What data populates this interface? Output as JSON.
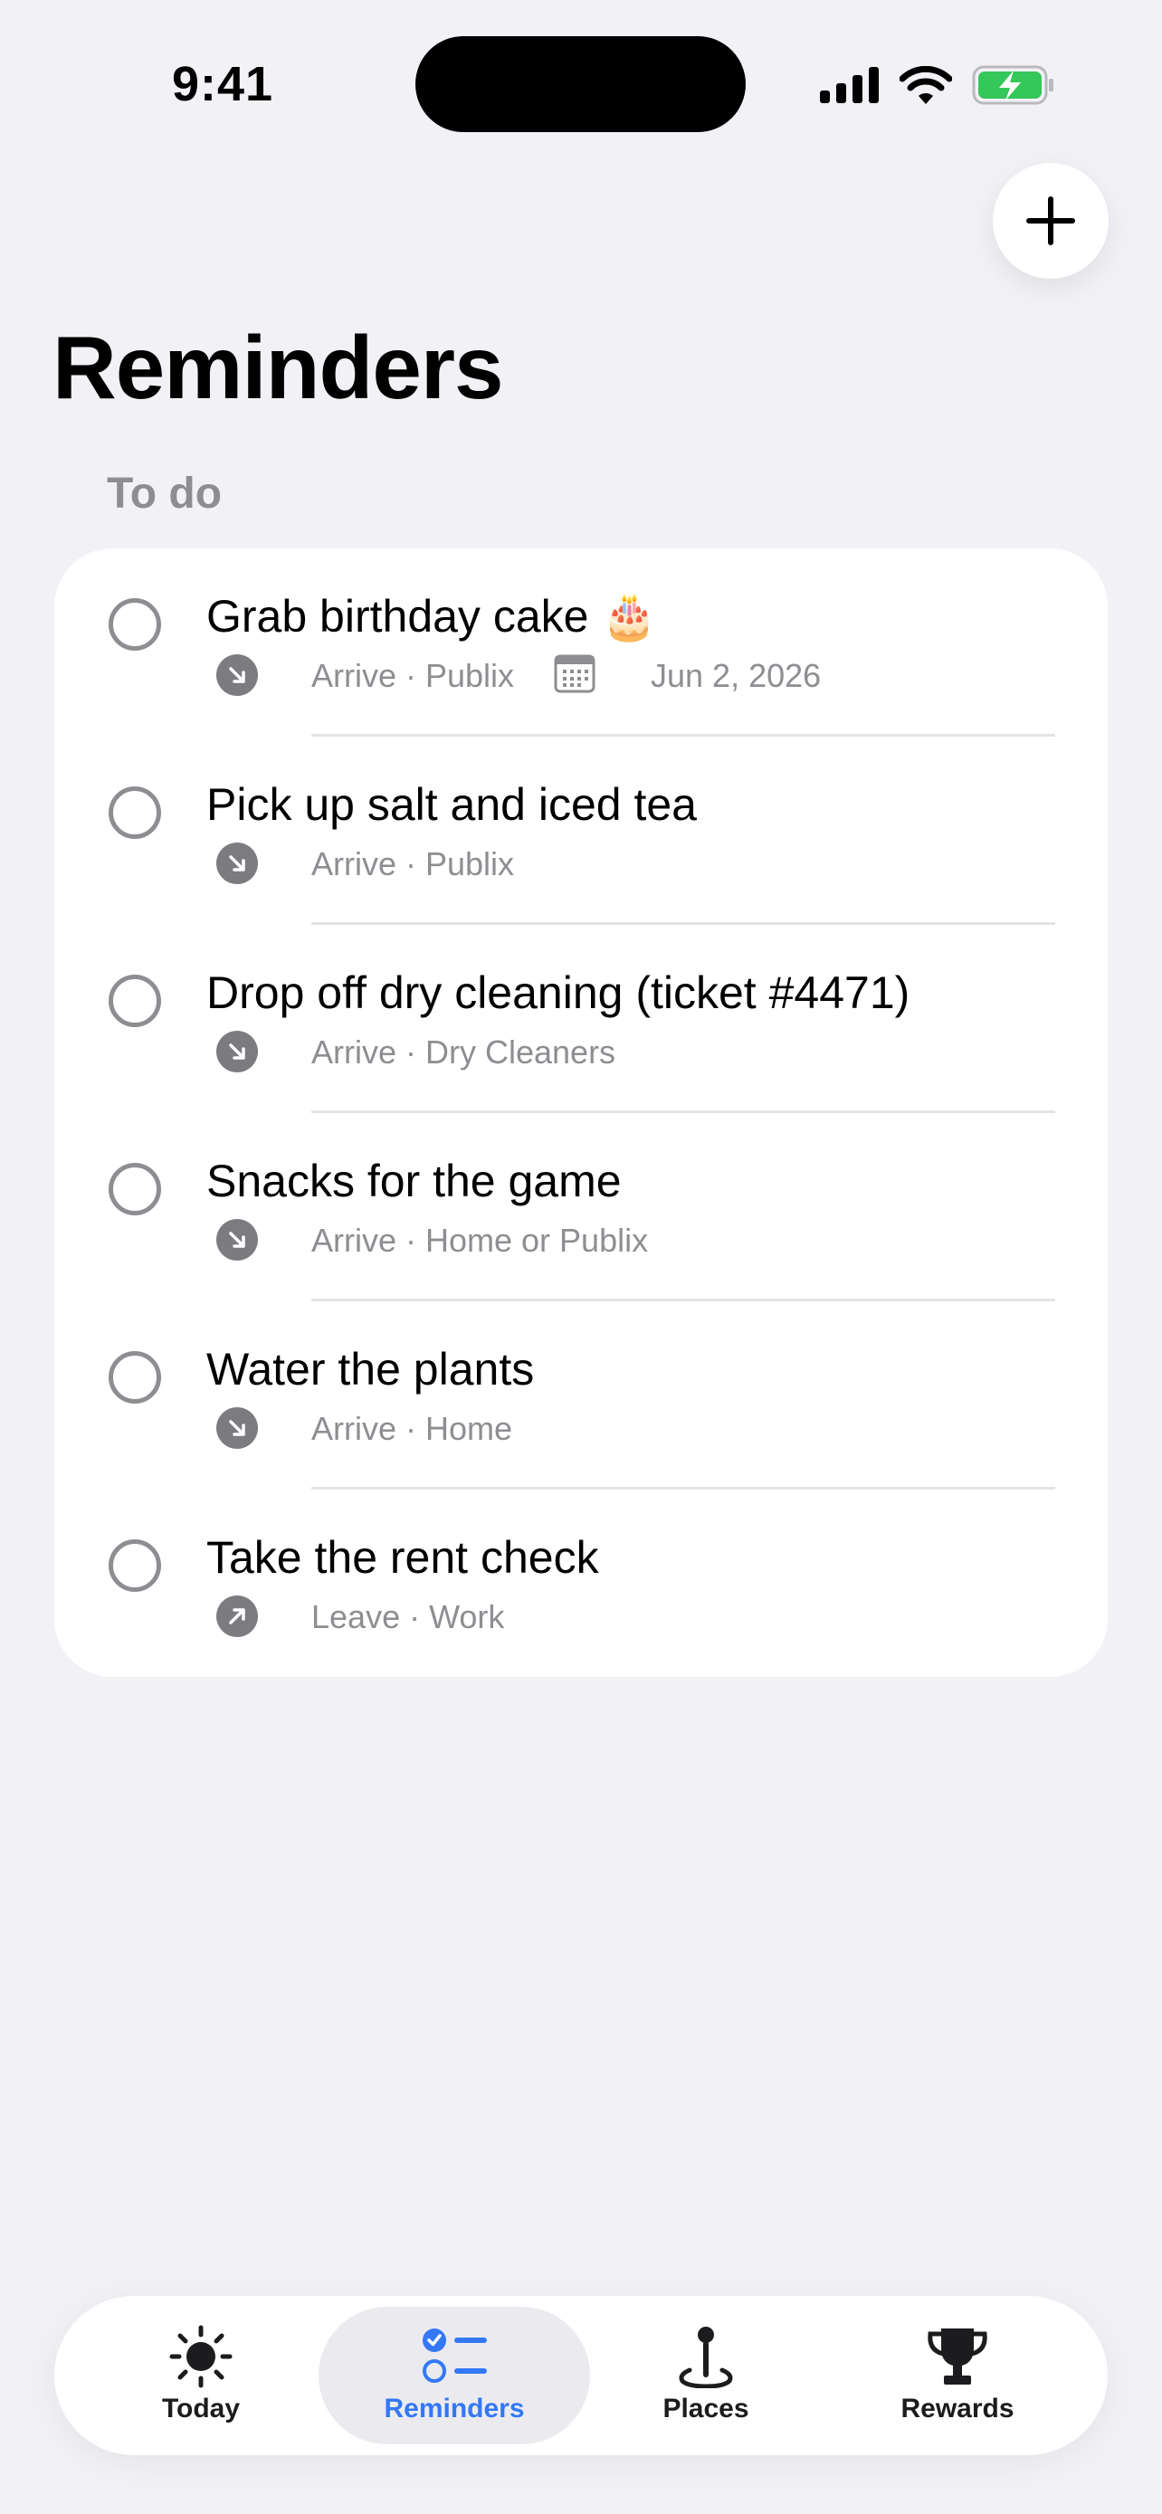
{
  "status_bar": {
    "time": "9:41"
  },
  "page": {
    "title": "Reminders",
    "section": "To do"
  },
  "reminders": [
    {
      "title": "Grab birthday cake 🎂",
      "trigger": "arrive",
      "meta": "Arrive · Publix",
      "date": "Jun 2, 2026"
    },
    {
      "title": "Pick up salt and iced tea",
      "trigger": "arrive",
      "meta": "Arrive · Publix"
    },
    {
      "title": "Drop off dry cleaning (ticket #4471)",
      "trigger": "arrive",
      "meta": "Arrive · Dry Cleaners"
    },
    {
      "title": "Snacks for the game",
      "trigger": "arrive",
      "meta": "Arrive · Home or Publix"
    },
    {
      "title": "Water the plants",
      "trigger": "arrive",
      "meta": "Arrive · Home"
    },
    {
      "title": "Take the rent check",
      "trigger": "leave",
      "meta": "Leave · Work"
    }
  ],
  "tabs": [
    {
      "label": "Today",
      "icon": "sun-icon"
    },
    {
      "label": "Reminders",
      "icon": "checklist-icon",
      "active": true
    },
    {
      "label": "Places",
      "icon": "pin-icon"
    },
    {
      "label": "Rewards",
      "icon": "trophy-icon"
    }
  ],
  "colors": {
    "accent": "#3478f6",
    "background": "#f2f1f6",
    "secondary_text": "#8e8d92",
    "battery": "#34c759"
  }
}
